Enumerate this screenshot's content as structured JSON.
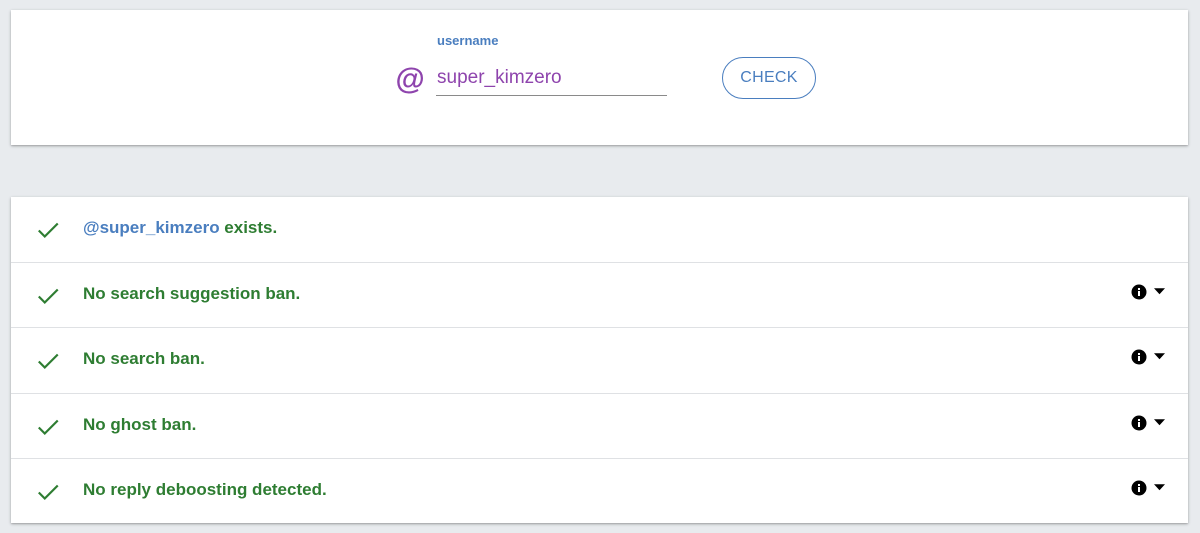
{
  "search": {
    "at_symbol": "@",
    "label": "username",
    "value": "super_kimzero",
    "button_label": "CHECK"
  },
  "results": [
    {
      "handle": "@super_kimzero",
      "text": " exists.",
      "status": "pass",
      "has_info": false
    },
    {
      "handle": "",
      "text": "No search suggestion ban.",
      "status": "pass",
      "has_info": true
    },
    {
      "handle": "",
      "text": "No search ban.",
      "status": "pass",
      "has_info": true
    },
    {
      "handle": "",
      "text": "No ghost ban.",
      "status": "pass",
      "has_info": true
    },
    {
      "handle": "",
      "text": "No reply deboosting detected.",
      "status": "pass",
      "has_info": true
    }
  ],
  "icons": {
    "status": "check-icon",
    "info": "info-icon",
    "expand": "caret-down-icon"
  },
  "colors": {
    "accent_blue": "#4a7ebf",
    "accent_purple": "#8e44ad",
    "success_green": "#2e7d32",
    "background": "#e8ebee"
  }
}
